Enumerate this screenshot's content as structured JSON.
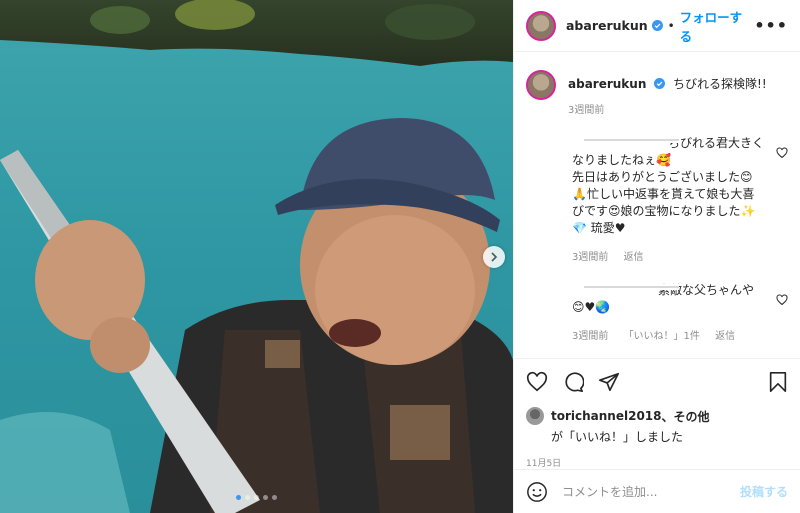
{
  "header": {
    "username": "abarerukun",
    "separator": "•",
    "follow_label": "フォローする",
    "more_label": "•••"
  },
  "caption": {
    "username": "abarerukun",
    "text": "ちびれる探検隊!!",
    "time": "3週間前"
  },
  "comments": [
    {
      "lines": [
        "ちびれる君大きく",
        "なりましたねぇ🥰",
        "先日はありがとうございました😊",
        "🙏忙しい中返事を貰えて娘も大喜",
        "びです😍娘の宝物になりました✨",
        "💎 琉愛♥"
      ],
      "time": "3週間前",
      "reply": "返信"
    },
    {
      "lines": [
        "素敵な父ちゃんや",
        "😊♥🌏"
      ],
      "time": "3週間前",
      "likes": "「いいね！」1件",
      "reply": "返信"
    }
  ],
  "actions": {
    "liker": "torichannel2018",
    "liked_by_suffix": "、その他",
    "liked_line2": "が「いいね！」しました",
    "date": "11月5日"
  },
  "add_comment": {
    "placeholder": "コメントを追加...",
    "post_label": "投稿する"
  },
  "carousel": {
    "count": 5,
    "active_index": 0
  },
  "colors": {
    "accent": "#0095f6",
    "post_disabled": "#b2dffc",
    "meta_gray": "#8e8e8e"
  },
  "icons": [
    "verified-badge-icon",
    "heart-icon",
    "comment-icon",
    "share-icon",
    "save-icon",
    "emoji-icon",
    "chevron-right-icon"
  ]
}
